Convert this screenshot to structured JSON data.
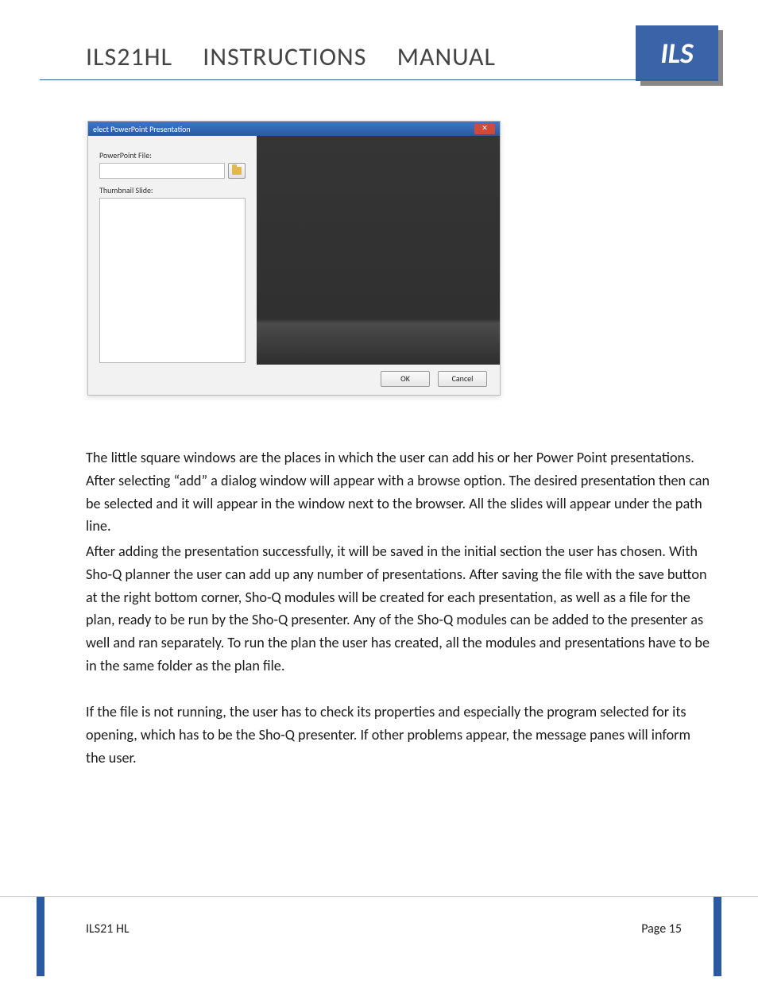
{
  "header": {
    "title": "ILS21HL INSTRUCTIONS MANUAL",
    "logo_text": "ILS"
  },
  "dialog": {
    "title": "elect PowerPoint Presentation",
    "labels": {
      "powerpoint_file": "PowerPoint File:",
      "thumbnail_slide": "Thumbnail Slide:"
    },
    "buttons": {
      "ok": "OK",
      "cancel": "Cancel"
    }
  },
  "paragraphs": {
    "p1": "The little square windows are the places in which the user can add his or her Power Point presentations. After selecting “add” a dialog window will appear with a browse option. The desired presentation then can be selected and it will appear in the window next to the browser. All the slides will appear under the path line.",
    "p2": "After adding the presentation successfully, it will be saved in the initial section the user has chosen. With Sho-Q planner the user can add up any number of presentations. After saving the file with the save button at the right bottom corner, Sho-Q modules will be created for each presentation, as well as a file for the plan, ready to be run by the Sho-Q presenter. Any of the Sho-Q modules can be added to the presenter as well and ran separately. To run the plan the user has created, all the modules and presentations have to be in the same folder as the plan file.",
    "p3": "If the file is not running, the user has to check its properties and especially the program selected for its opening, which has to be the Sho-Q presenter. If other problems appear, the message panes will inform the user."
  },
  "footer": {
    "left": "ILS21 HL",
    "right": "Page 15"
  }
}
